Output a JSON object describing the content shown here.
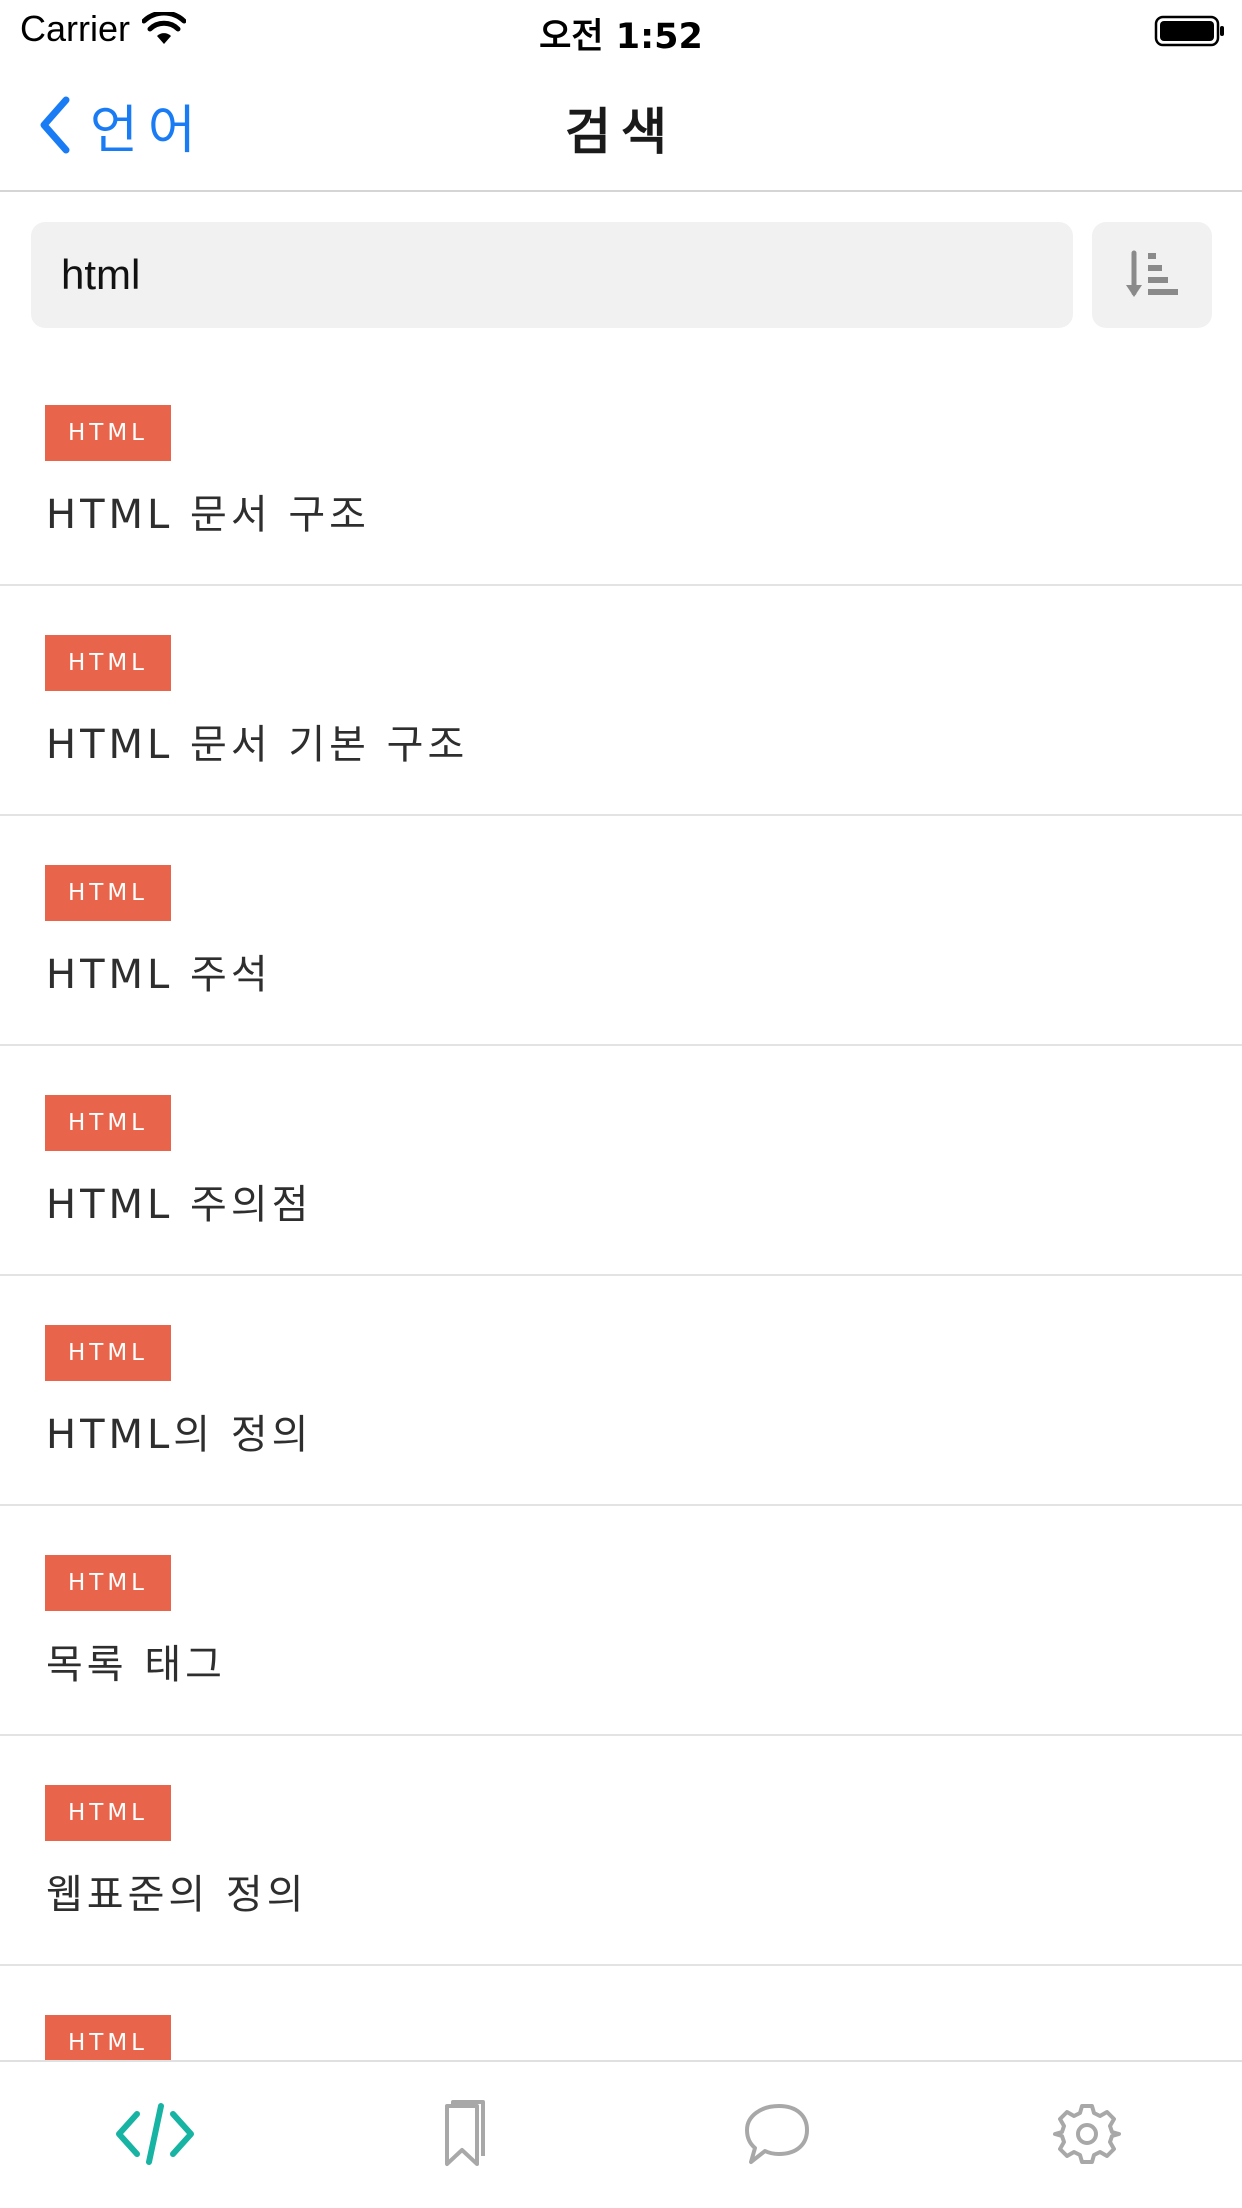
{
  "status_bar": {
    "carrier": "Carrier",
    "time": "오전 1:52"
  },
  "nav": {
    "back_label": "언어",
    "title": "검색"
  },
  "search": {
    "value": "html"
  },
  "results": [
    {
      "tag": "HTML",
      "title": "HTML 문서 구조"
    },
    {
      "tag": "HTML",
      "title": "HTML 문서 기본 구조"
    },
    {
      "tag": "HTML",
      "title": "HTML 주석"
    },
    {
      "tag": "HTML",
      "title": "HTML 주의점"
    },
    {
      "tag": "HTML",
      "title": "HTML의 정의"
    },
    {
      "tag": "HTML",
      "title": "목록 태그"
    },
    {
      "tag": "HTML",
      "title": "웹표준의 정의"
    },
    {
      "tag": "HTML",
      "title": ""
    }
  ],
  "tab_bar": {
    "items": [
      {
        "icon": "code-icon",
        "active": true
      },
      {
        "icon": "bookmark-icon",
        "active": false
      },
      {
        "icon": "chat-icon",
        "active": false
      },
      {
        "icon": "gear-icon",
        "active": false
      }
    ]
  },
  "colors": {
    "accent": "#1a7cf5",
    "tag": "#e8654b",
    "tab_active": "#17b3a3",
    "tab_inactive": "#a8a8a8"
  }
}
